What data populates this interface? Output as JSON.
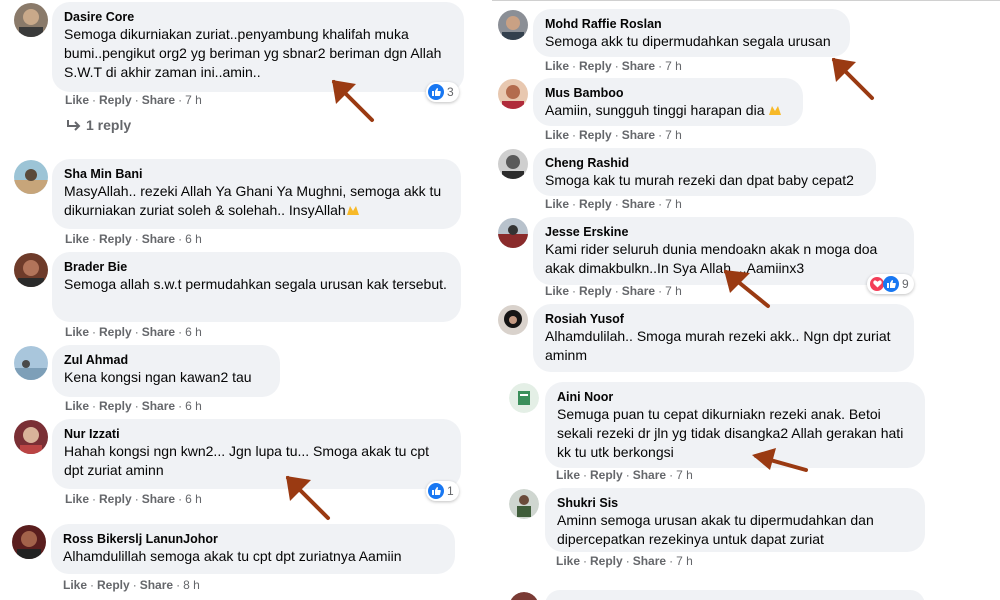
{
  "left": [
    {
      "author": "Dasire Core",
      "text": "Semoga dikurniakan zuriat..penyambung khalifah muka bumi..pengikut org2 yg beriman yg sbnar2 beriman dgn Allah S.W.T di akhir zaman ini..amin..",
      "time": "7 h",
      "reactions": "3"
    },
    {
      "author": "Sha Min Bani",
      "text": "MasyAllah.. rezeki Allah Ya Ghani Ya Mughni, semoga akk tu dikurniakan zuriat soleh & solehah.. InsyAllah",
      "time": "6 h"
    },
    {
      "author": "Brader Bie",
      "text": "Semoga allah s.w.t permudahkan segala urusan kak tersebut.",
      "time": "6 h"
    },
    {
      "author": "Zul Ahmad",
      "text": "Kena kongsi ngan kawan2 tau",
      "time": "6 h"
    },
    {
      "author": "Nur Izzati",
      "text": "Hahah kongsi ngn kwn2... Jgn lupa tu... Smoga akak tu cpt dpt zuriat aminn",
      "time": "6 h",
      "reactions": "1"
    },
    {
      "author": "Ross Bikerslj LanunJohor",
      "text": "Alhamdulillah semoga akak tu cpt dpt zuriatnya Aamiin",
      "time": "8 h"
    }
  ],
  "right": [
    {
      "author": "Mohd Raffie Roslan",
      "text": "Semoga akk tu dipermudahkan segala urusan",
      "time": "7 h"
    },
    {
      "author": "Mus Bamboo",
      "text": "Aamiin, sungguh tinggi harapan dia",
      "time": "7 h"
    },
    {
      "author": "Cheng Rashid",
      "text": "Smoga kak tu murah rezeki dan dpat baby cepat2",
      "time": "7 h"
    },
    {
      "author": "Jesse Erskine",
      "text": "Kami rider seluruh dunia mendoakn akak n moga doa akak dimakbulkn..In Sya Allah....Aamiinx3",
      "time": "7 h",
      "reactions": "9"
    },
    {
      "author": "Rosiah Yusof",
      "text": "Alhamdulilah.. Smoga murah rezeki akk.. Ngn dpt zuriat aminm",
      "time": ""
    },
    {
      "author": "Aini Noor",
      "text": "Semuga puan tu cepat dikurniakn rezeki anak. Betoi sekali rezeki dr jln yg tidak disangka2 Allah gerakan hati kk tu utk berkongsi",
      "time": "7 h"
    },
    {
      "author": "Shukri Sis",
      "text": "Aminn semoga urusan akak tu dipermudahkan dan dipercepatkan rezekinya untuk dapat zuriat",
      "time": "7 h"
    }
  ],
  "labels": {
    "like": "Like",
    "reply": "Reply",
    "share": "Share",
    "dot": "·",
    "one_reply": "1 reply"
  },
  "colors": {
    "bubble": "#f0f2f5",
    "action_text": "#65676b",
    "like_blue": "#1877f2",
    "love_red": "#f33e58",
    "arrow": "#9a3a12"
  }
}
